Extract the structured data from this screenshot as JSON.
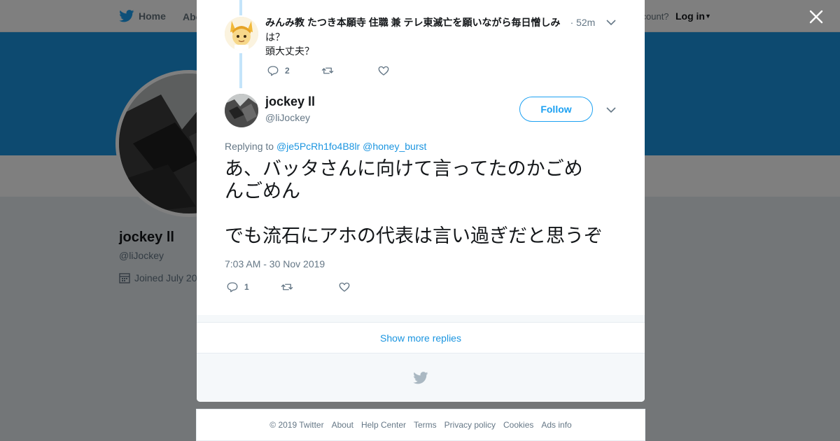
{
  "background": {
    "nav": {
      "home": "Home",
      "about": "Abo",
      "account": "ccount?",
      "login": "Log in"
    },
    "profile": {
      "name": "jockey ll",
      "handle": "@liJockey",
      "joined": "Joined July 20"
    },
    "colors": {
      "banner": "#1b95e0",
      "overlay": "rgba(0,0,0,0.5)"
    }
  },
  "close_icon": "close-icon",
  "reply_tweet": {
    "name": "みんみ教 たつき本願寺 住職 兼 テレ東滅亡を願いながら毎日憎しみ",
    "time": "· 52m",
    "text_lines": [
      "は？",
      "頭大丈夫？"
    ],
    "reply_count": "2",
    "retweet_count": "",
    "like_count": ""
  },
  "main_tweet": {
    "name": "jockey ll",
    "handle": "@liJockey",
    "follow_label": "Follow",
    "replying_prefix": "Replying to",
    "replying_to": [
      "@je5PcRh1fo4B8lr",
      "@honey_burst"
    ],
    "text_line1": "あ、バッタさんに向けて言ってたのかごめ",
    "text_line2": "んごめん",
    "text_line3": "でも流石にアホの代表は言い過ぎだと思うぞ",
    "date": "7:03 AM - 30 Nov 2019",
    "reply_count": "1",
    "retweet_count": "",
    "like_count": ""
  },
  "show_more": "Show more replies",
  "footer": {
    "copyright": "© 2019 Twitter",
    "links": [
      "About",
      "Help Center",
      "Terms",
      "Privacy policy",
      "Cookies",
      "Ads info"
    ]
  }
}
